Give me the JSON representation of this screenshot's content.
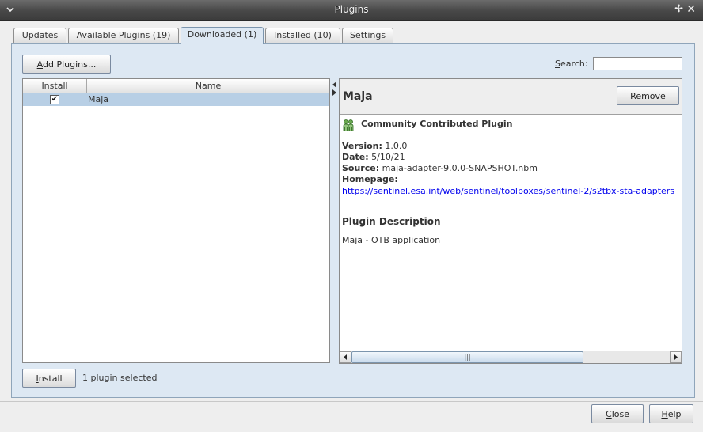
{
  "window": {
    "title": "Plugins"
  },
  "tabs": [
    {
      "label": "Updates"
    },
    {
      "label": "Available Plugins (19)"
    },
    {
      "label": "Downloaded (1)",
      "active": true
    },
    {
      "label": "Installed (10)"
    },
    {
      "label": "Settings"
    }
  ],
  "toolbar": {
    "add_plugins_label": "Add Plugins...",
    "search_label": "Search:",
    "search_value": ""
  },
  "table": {
    "columns": [
      "Install",
      "Name"
    ],
    "rows": [
      {
        "install": true,
        "name": "Maja"
      }
    ]
  },
  "detail": {
    "name": "Maja",
    "remove_label": "Remove",
    "category": "Community Contributed Plugin",
    "version_label": "Version:",
    "version": "1.0.0",
    "date_label": "Date:",
    "date": "5/10/21",
    "source_label": "Source:",
    "source": "maja-adapter-9.0.0-SNAPSHOT.nbm",
    "homepage_label": "Homepage:",
    "homepage": "https://sentinel.esa.int/web/sentinel/toolboxes/sentinel-2/s2tbx-sta-adapters",
    "description_title": "Plugin Description",
    "description": "Maja - OTB application"
  },
  "footer": {
    "install_label": "Install",
    "status": "1 plugin selected",
    "close_label": "Close",
    "help_label": "Help"
  },
  "icons": {
    "window_menu": "chevron-down-icon",
    "pin": "pin-icon",
    "close": "close-icon",
    "checkbox": "checkmark-icon",
    "category": "people-icon",
    "scroll_left": "arrow-left-icon",
    "scroll_right": "arrow-right-icon"
  },
  "colors": {
    "panel": "#dde8f3",
    "selection": "#b8cfe5",
    "link": "#0000ee",
    "titlebar": "#484848"
  }
}
